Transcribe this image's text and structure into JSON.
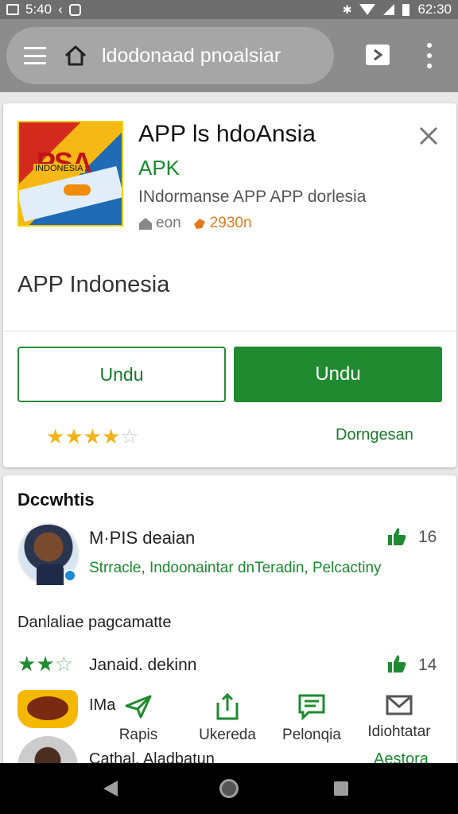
{
  "status_bar": {
    "time": "5:40",
    "clock_right": "62:30"
  },
  "browser": {
    "url": "ldodonaad pnoalsiar"
  },
  "app": {
    "title": "APP ls hdoAnsia",
    "type": "APK",
    "description": "INdormanse APP APP dorlesia",
    "meta_left": "eon",
    "meta_right": "2930n",
    "name_large": "APP Indonesia",
    "icon_letters": "PSA",
    "icon_subtext": "INDONESIA",
    "btn_outline": "Undu",
    "btn_primary": "Undu",
    "rating": 4,
    "rating_max": 5,
    "rate_link": "Dorngesan"
  },
  "reviews": {
    "section_title": "Dccwhtis",
    "first": {
      "name": "M·PIS  deaian",
      "text": "Strracle, Indoonaintar dnTeradin, Pelcactiny",
      "likes": "16"
    },
    "second": {
      "title": "Danlaliae pagcamatte",
      "name": "Janaid. dekinn",
      "rating": 2.5,
      "likes": "14"
    },
    "third": {
      "short_name": "IMa",
      "name": "Cathal. Aladbatun",
      "link": "Aestora"
    }
  },
  "actions": [
    {
      "label": "Rapis",
      "icon": "send-icon"
    },
    {
      "label": "Ukereda",
      "icon": "share-icon"
    },
    {
      "label": "Pelonqia",
      "icon": "message-icon"
    },
    {
      "label": "Idiohtatar",
      "icon": "mail-icon"
    }
  ],
  "colors": {
    "accent_green": "#1f8a30",
    "star_yellow": "#f2b31a",
    "meta_orange": "#e57a1c",
    "toolbar_gray": "#8c8c8c"
  }
}
